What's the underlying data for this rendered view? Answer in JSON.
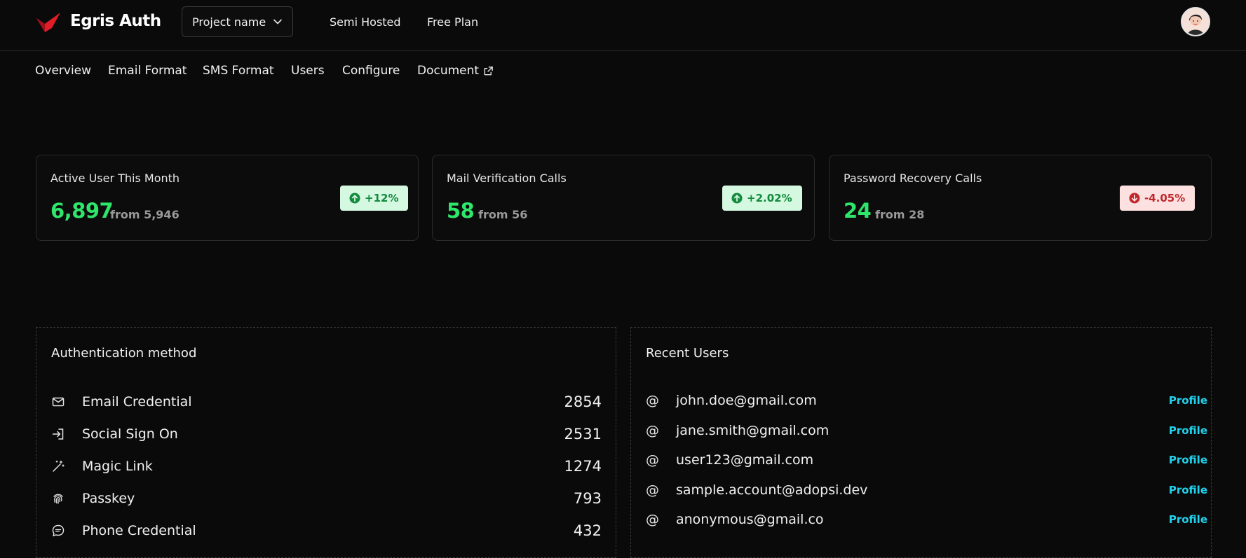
{
  "header": {
    "brand": "Egris Auth",
    "project_select": "Project name",
    "links": [
      "Semi Hosted",
      "Free Plan"
    ]
  },
  "nav": {
    "tabs": [
      "Overview",
      "Email Format",
      "SMS Format",
      "Users",
      "Configure",
      "Document"
    ]
  },
  "stats": [
    {
      "title": "Active User This Month",
      "value": "6,897",
      "from": "from 5,946",
      "change": "+12%",
      "trend": "up"
    },
    {
      "title": "Mail Verification Calls",
      "value": "58",
      "from": "from 56",
      "change": "+2.02%",
      "trend": "up"
    },
    {
      "title": "Password Recovery Calls",
      "value": "24",
      "from": "from 28",
      "change": "-4.05%",
      "trend": "down"
    }
  ],
  "auth_panel": {
    "title": "Authentication method",
    "methods": [
      {
        "name": "Email Credential",
        "count": "2854",
        "icon": "mail-icon"
      },
      {
        "name": "Social Sign On",
        "count": "2531",
        "icon": "sign-in-icon"
      },
      {
        "name": "Magic Link",
        "count": "1274",
        "icon": "magic-wand-icon"
      },
      {
        "name": "Passkey",
        "count": "793",
        "icon": "fingerprint-icon"
      },
      {
        "name": "Phone Credential",
        "count": "432",
        "icon": "message-icon"
      }
    ]
  },
  "recent_users": {
    "title": "Recent Users",
    "at_symbol": "@",
    "profile_label": "Profile",
    "users": [
      "john.doe@gmail.com",
      "jane.smith@gmail.com",
      "user123@gmail.com",
      "sample.account@adopsi.dev",
      "anonymous@gmail.co"
    ]
  },
  "colors": {
    "accent_green": "#2ee66b",
    "brand_red": "#e11d2a",
    "profile_cyan": "#22d3ee",
    "background": "#0a0a0a"
  }
}
